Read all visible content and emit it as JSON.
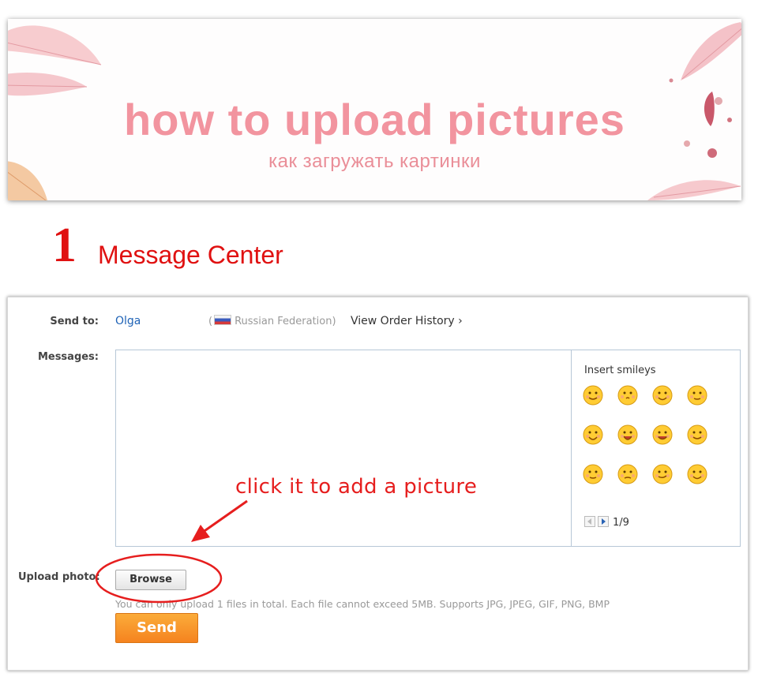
{
  "banner": {
    "title": "how to upload pictures",
    "subtitle": "как загружать картинки"
  },
  "step": {
    "number": "1",
    "title": "Message Center"
  },
  "form": {
    "send_to_label": "Send to:",
    "recipient_name": "Olga",
    "country": "Russian Federation",
    "country_paren_open": "(",
    "country_paren_close": ")",
    "order_history": "View Order History",
    "order_history_arrow": "›",
    "messages_label": "Messages:",
    "smileys": {
      "title": "Insert smileys",
      "page_indicator": "1/9",
      "items": [
        "smile-icon",
        "kiss-icon",
        "wink-tongue-icon",
        "blush-icon",
        "tongue-out-icon",
        "laugh-big-mouth-icon",
        "crying-laugh-icon",
        "giggle-icon",
        "shy-hands-icon",
        "tired-icon",
        "smirk-icon",
        "hands-on-cheeks-icon"
      ]
    },
    "upload_label": "Upload photo:",
    "browse_label": "Browse",
    "upload_note": "You can only upload 1 files in total. Each file cannot exceed 5MB. Supports JPG, JPEG, GIF, PNG, BMP",
    "send_label": "Send"
  },
  "annotation": {
    "text": "click it to add a picture"
  },
  "colors": {
    "banner_pink": "#f2949f",
    "step_red": "#e01111",
    "link_blue": "#1f63b6",
    "send_orange": "#f5831f",
    "annotation_red": "#e61e1e"
  }
}
